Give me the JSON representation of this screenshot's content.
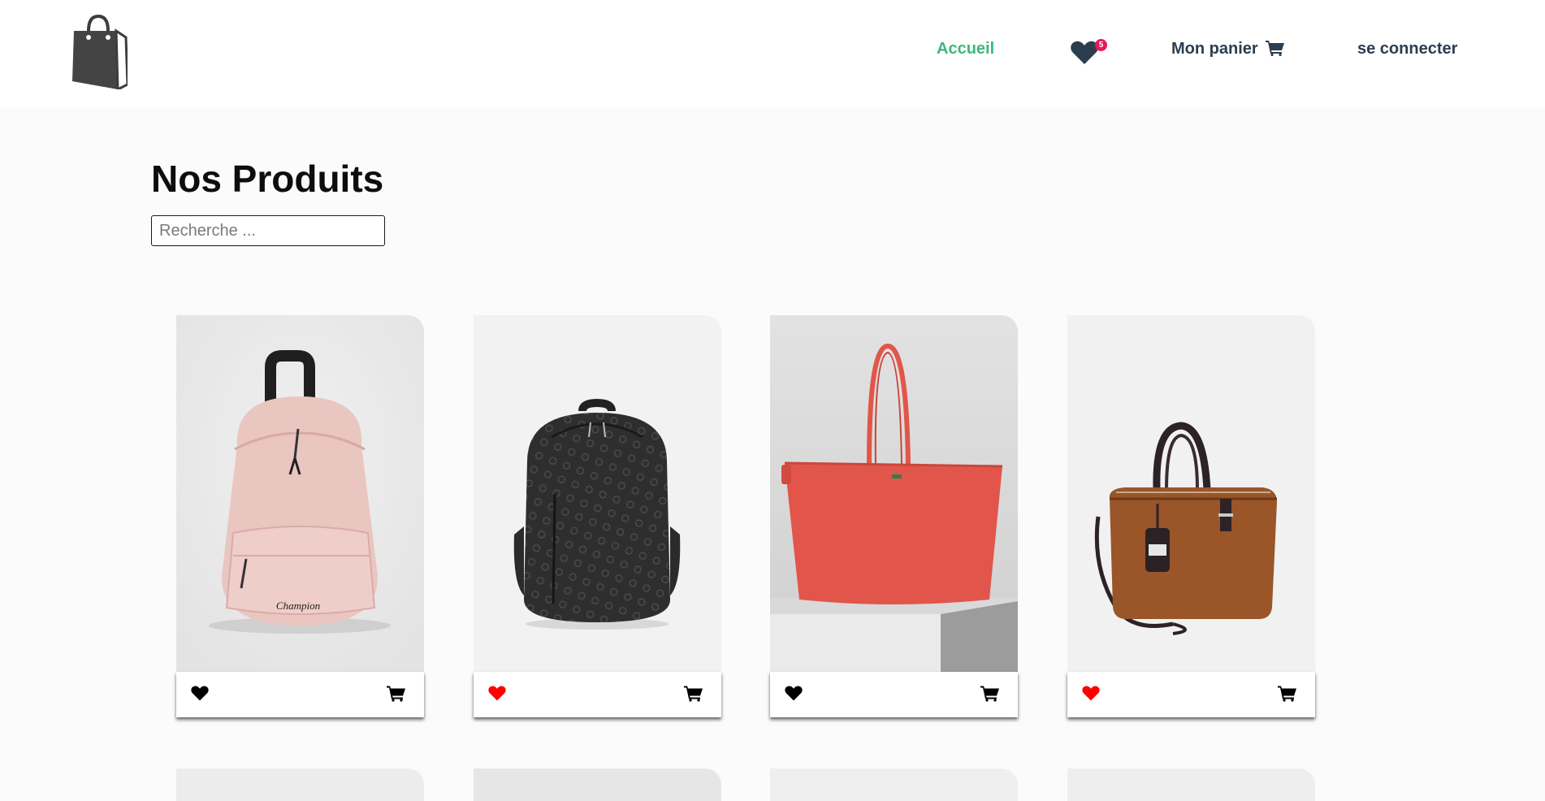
{
  "header": {
    "logo_icon": "shopping-bag-icon",
    "nav": {
      "home_label": "Accueil",
      "favorites_icon": "heart-icon",
      "favorites_count": "5",
      "cart_label": "Mon panier",
      "cart_icon": "cart-icon",
      "login_label": "se connecter"
    }
  },
  "main": {
    "title": "Nos Produits",
    "search": {
      "placeholder": "Recherche ..."
    }
  },
  "products": [
    {
      "image": "pink-champion-backpack",
      "favorite": false
    },
    {
      "image": "dark-monogram-backpack",
      "favorite": true
    },
    {
      "image": "red-tote-bag",
      "favorite": false
    },
    {
      "image": "brown-leather-handbag",
      "favorite": true
    }
  ],
  "colors": {
    "accent": "#3cb878",
    "nav_text": "#2b3e50",
    "badge": "#e6195a",
    "favorite_active": "#ff0000",
    "favorite_inactive": "#000000"
  }
}
